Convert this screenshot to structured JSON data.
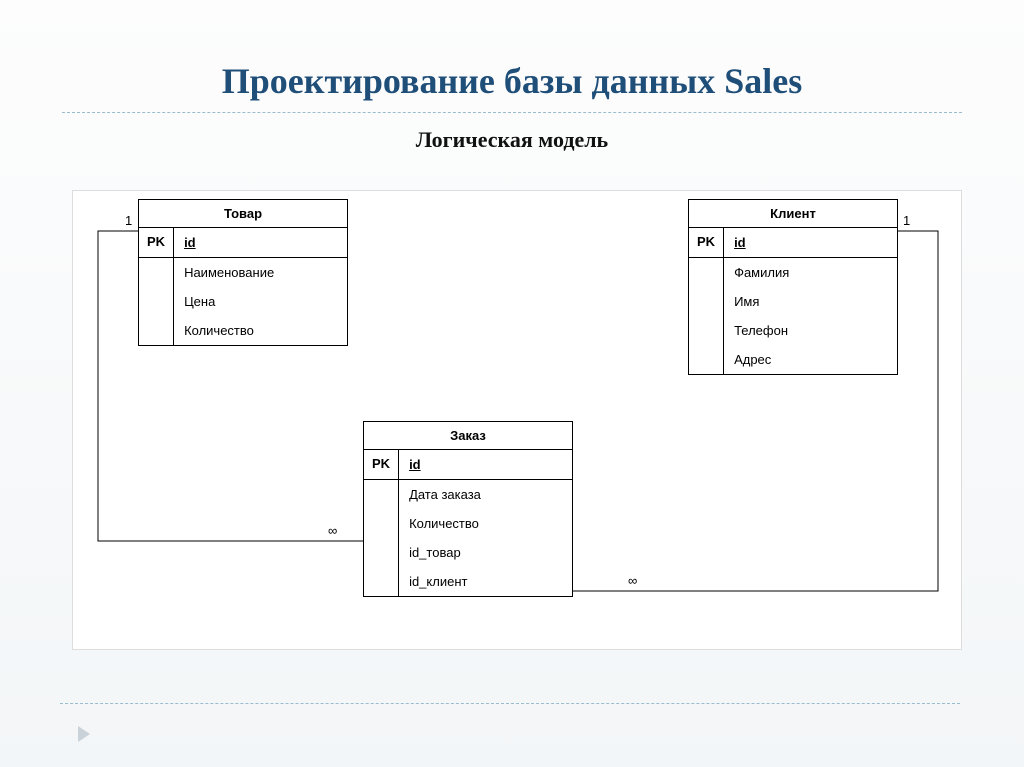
{
  "title": "Проектирование базы данных Sales",
  "subtitle": "Логическая  модель",
  "entities": {
    "product": {
      "name": "Товар",
      "pk_label": "PK",
      "pk_field": "id",
      "attrs": [
        "Наименование",
        "Цена",
        "Количество"
      ]
    },
    "client": {
      "name": "Клиент",
      "pk_label": "PK",
      "pk_field": "id",
      "attrs": [
        "Фамилия",
        "Имя",
        "Телефон",
        "Адрес"
      ]
    },
    "order": {
      "name": "Заказ",
      "pk_label": "PK",
      "pk_field": "id",
      "attrs": [
        "Дата заказа",
        "Количество",
        "id_товар",
        "id_клиент"
      ]
    }
  },
  "cardinality": {
    "one_left": "1",
    "one_right": "1",
    "many_left": "∞",
    "many_right": "∞"
  }
}
